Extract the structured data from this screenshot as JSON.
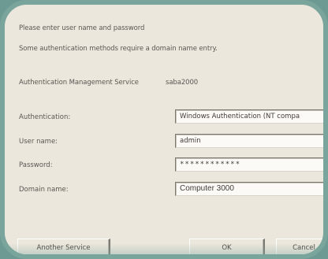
{
  "dialog": {
    "line1": "Please enter user name and password",
    "line2": "Some authentication methods require a domain name entry.",
    "service_label": "Authentication Management Service",
    "service_value": "saba2000"
  },
  "form": {
    "authentication_label": "Authentication:",
    "authentication_value": "Windows Authentication (NT compa",
    "username_label": "User name:",
    "username_value": "admin",
    "password_label": "Password:",
    "password_value": "************",
    "domain_label": "Domain name:",
    "domain_value": "Computer 3000"
  },
  "buttons": {
    "another_service": "Another Service",
    "ok": "OK",
    "cancel": "Cancel"
  },
  "colors": {
    "background": "#6d9a92",
    "dialog": "#ece7dd",
    "border": "#7aa59c"
  }
}
